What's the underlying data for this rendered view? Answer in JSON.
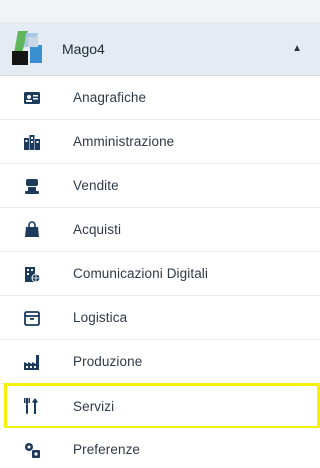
{
  "header": {
    "title": "Mago4",
    "caret": "▲"
  },
  "menu": {
    "items": [
      {
        "label": "Anagrafiche",
        "icon": "address-card-icon"
      },
      {
        "label": "Amministrazione",
        "icon": "buildings-icon"
      },
      {
        "label": "Vendite",
        "icon": "sales-person-icon"
      },
      {
        "label": "Acquisti",
        "icon": "shopping-bag-icon"
      },
      {
        "label": "Comunicazioni Digitali",
        "icon": "digital-building-icon"
      },
      {
        "label": "Logistica",
        "icon": "box-icon"
      },
      {
        "label": "Produzione",
        "icon": "factory-icon"
      },
      {
        "label": "Servizi",
        "icon": "tools-icon",
        "highlighted": true
      },
      {
        "label": "Preferenze",
        "icon": "preferences-gears-icon"
      }
    ]
  },
  "colors": {
    "icon": "#1b3a5c",
    "highlight_border": "#f5f10a",
    "header_background": "#e4ebf3"
  }
}
